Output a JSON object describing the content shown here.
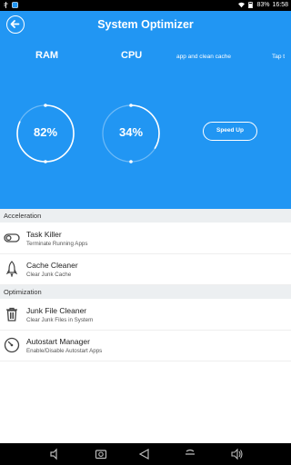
{
  "status": {
    "battery": "83%",
    "time": "16:58"
  },
  "header": {
    "title": "System Optimizer",
    "ram_label": "RAM",
    "cpu_label": "CPU",
    "tip_text": "app and clean cache",
    "tip_right": "Tap t",
    "ram_value": "82%",
    "cpu_value": "34%",
    "ram_percent": 82,
    "cpu_percent": 34,
    "speed_label": "Speed Up"
  },
  "sections": [
    {
      "title": "Acceleration"
    },
    {
      "title": "Optimization"
    }
  ],
  "items": [
    {
      "title": "Task Killer",
      "subtitle": "Terminate Running Apps",
      "icon": "toggle-icon"
    },
    {
      "title": "Cache Cleaner",
      "subtitle": "Clear Junk Cache",
      "icon": "rocket-icon"
    },
    {
      "title": "Junk File Cleaner",
      "subtitle": "Clear Junk Files in System",
      "icon": "trash-icon"
    },
    {
      "title": "Autostart Manager",
      "subtitle": "Enable/Disable Autostart Apps",
      "icon": "gauge-icon"
    }
  ],
  "colors": {
    "primary": "#2196F3",
    "section_bg": "#eceff1"
  }
}
